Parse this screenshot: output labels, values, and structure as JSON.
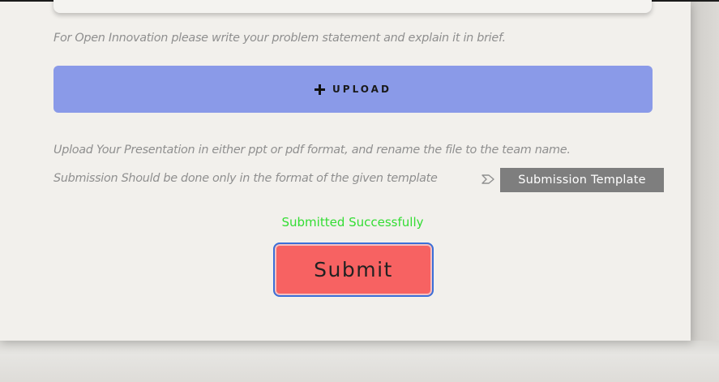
{
  "form": {
    "open_innovation_hint": "For Open Innovation please write your problem statement  and explain it in brief.",
    "upload_button_label": "UPLOAD",
    "upload_hint": "Upload Your Presentation in either ppt or pdf format, and rename the file to the team name.",
    "template_hint": "Submission Should be done only in the format of the given template",
    "template_button_label": "Submission Template",
    "status_message": "Submitted Successfully",
    "submit_button_label": "Submit"
  },
  "icons": {
    "upload": "plus-icon",
    "template_pointer": "arrow-right-icon"
  },
  "colors": {
    "upload_button": "#8a9ae8",
    "submit_button": "#f76262",
    "submit_focus_ring": "#3b6fd8",
    "template_button": "#7e7e7e",
    "success_text": "#33dd33",
    "hint_text": "#8f8f8f"
  }
}
